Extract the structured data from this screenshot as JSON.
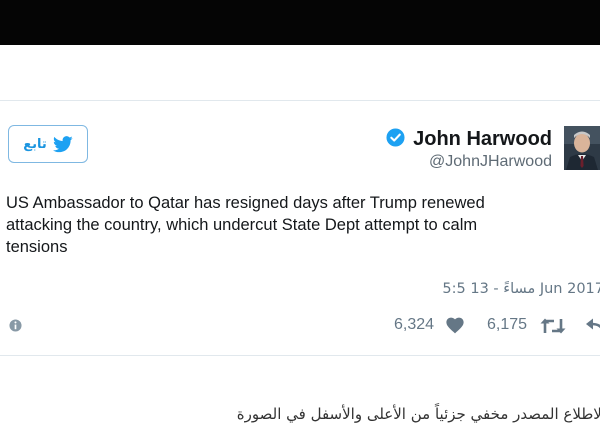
{
  "tweet": {
    "author": {
      "name": "John Harwood",
      "handle": "@JohnJHarwood",
      "verified": true
    },
    "follow_label": "تابع",
    "text_lines": [
      "US Ambassador to Qatar has resigned days after Trump renewed",
      "attacking the country, which undercut State Dept attempt to calm",
      "tensions"
    ],
    "timestamp": "5:5 مساءً - 13 Jun 2017",
    "stats": {
      "likes": "6,324",
      "retweets": "6,175"
    },
    "icons": [
      "twitter-bird-icon",
      "verified-badge-icon",
      "info-icon",
      "heart-icon",
      "retweet-icon",
      "reply-icon"
    ],
    "colors": {
      "accent": "#1da1f2",
      "muted": "#657786",
      "top_bar": "#050505"
    }
  },
  "article": {
    "text": "الاطلاع المصدر مخفي جزئياً من الأعلى والأسفل في الصورة"
  }
}
